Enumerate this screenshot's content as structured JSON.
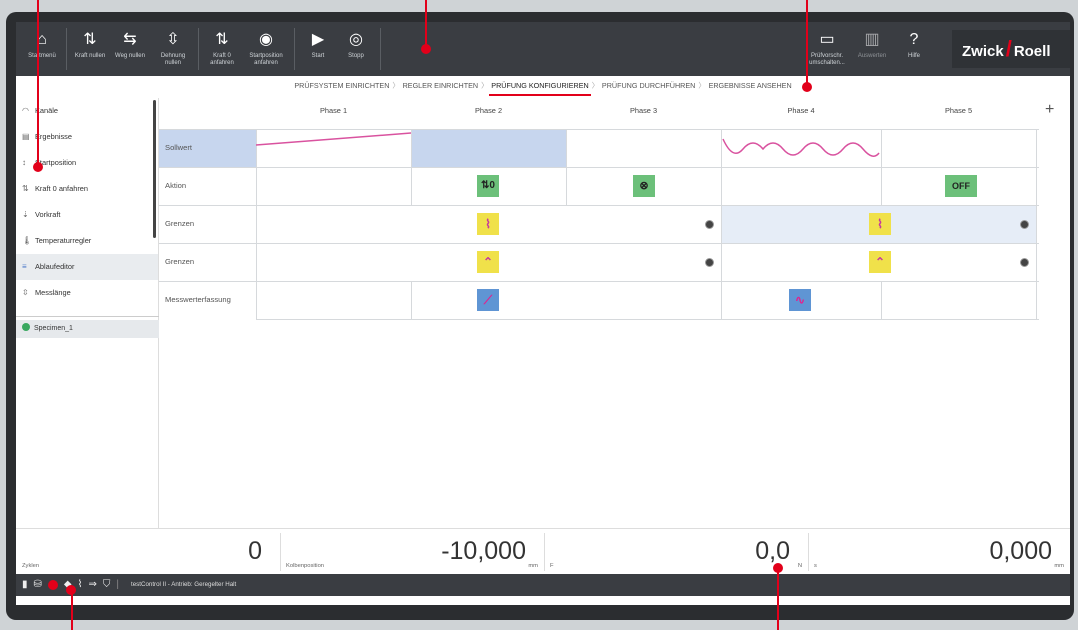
{
  "toolbar": {
    "items": [
      {
        "icon": "home-icon",
        "glyph": "⌂",
        "label": "Startmenü"
      },
      {
        "icon": "force-zero-icon",
        "glyph": "⇅",
        "label": "Kraft nullen"
      },
      {
        "icon": "travel-zero-icon",
        "glyph": "⇆",
        "label": "Weg nullen"
      },
      {
        "icon": "strain-zero-icon",
        "glyph": "⇳",
        "label": "Dehnung nullen"
      },
      {
        "icon": "approach-force-icon",
        "glyph": "⇅",
        "label": "Kraft 0 anfahren"
      },
      {
        "icon": "start-position-icon",
        "glyph": "◉",
        "label": "Startposition anfahren"
      },
      {
        "icon": "start-icon",
        "glyph": "▶",
        "label": "Start"
      },
      {
        "icon": "stop-icon",
        "glyph": "◎",
        "label": "Stopp"
      },
      {
        "icon": "folder-icon",
        "glyph": "▭",
        "label": "Prüfvorschr. umschalten..."
      },
      {
        "icon": "evaluate-icon",
        "glyph": "▥",
        "label": "Auswerten"
      },
      {
        "icon": "help-icon",
        "glyph": "?",
        "label": "Hilfe"
      }
    ],
    "logo": {
      "left": "Zwick",
      "right": "Roell"
    }
  },
  "steps": [
    {
      "label": "PRÜFSYSTEM EINRICHTEN",
      "active": false
    },
    {
      "label": "REGLER EINRICHTEN",
      "active": false
    },
    {
      "label": "PRÜFUNG KONFIGURIEREN",
      "active": true
    },
    {
      "label": "PRÜFUNG DURCHFÜHREN",
      "active": false
    },
    {
      "label": "ERGEBNISSE ANSEHEN",
      "active": false
    }
  ],
  "sidebar": {
    "items": [
      {
        "icon": "gauge-icon",
        "label": "Kanäle"
      },
      {
        "icon": "results-icon",
        "label": "Ergebnisse"
      },
      {
        "icon": "position-icon",
        "label": "Startposition"
      },
      {
        "icon": "approach-force-icon",
        "label": "Kraft 0 anfahren"
      },
      {
        "icon": "preload-icon",
        "label": "Vorkraft"
      },
      {
        "icon": "thermometer-icon",
        "label": "Temperaturregler"
      },
      {
        "icon": "sequence-editor-icon",
        "label": "Ablaufeditor",
        "selected": true
      },
      {
        "icon": "gauge-length-icon",
        "label": "Messlänge"
      }
    ],
    "specimen": "Specimen_1"
  },
  "grid": {
    "phases": [
      "Phase 1",
      "Phase 2",
      "Phase 3",
      "Phase 4",
      "Phase 5"
    ],
    "rows": [
      "Sollwert",
      "Aktion",
      "Grenzen",
      "Grenzen",
      "Messwerterfassung"
    ],
    "action_off_label": "OFF"
  },
  "status": {
    "cycles": {
      "label": "Zyklen",
      "value": "0",
      "unit": ""
    },
    "piston": {
      "label": "Kolbenposition",
      "value": "-10,000",
      "unit": "mm"
    },
    "force": {
      "label": "F",
      "value": "0,0",
      "unit": "N"
    },
    "travel": {
      "label": "s",
      "value": "0,000",
      "unit": "mm"
    }
  },
  "bottombar": {
    "text": "testControl II - Antrieb: Geregelter Halt"
  },
  "colors": {
    "accent": "#e2001a",
    "toolbar": "#3a3d42",
    "selected_cell": "#c7d6ee",
    "icon_yellow": "#f0e14a",
    "icon_green": "#6cc07a",
    "icon_blue": "#5f95d4"
  }
}
